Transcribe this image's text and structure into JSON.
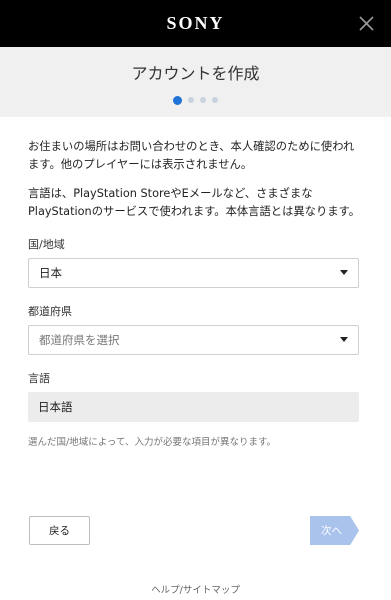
{
  "header": {
    "brand": "SONY",
    "title": "アカウントを作成",
    "steps_total": 4,
    "steps_current": 1
  },
  "intro": {
    "text1": "お住まいの場所はお問い合わせのとき、本人確認のために使われます。他のプレイヤーには表示されません。",
    "text2": "言語は、PlayStation StoreやEメールなど、さまざまなPlayStationのサービスで使われます。本体言語とは異なります。"
  },
  "fields": {
    "country": {
      "label": "国/地域",
      "value": "日本"
    },
    "prefecture": {
      "label": "都道府県",
      "placeholder": "都道府県を選択"
    },
    "language": {
      "label": "言語",
      "value": "日本語"
    }
  },
  "note": "選んだ国/地域によって、入力が必要な項目が異なります。",
  "buttons": {
    "back": "戻る",
    "next": "次へ"
  },
  "footer": {
    "link": "ヘルプ/サイトマップ"
  },
  "colors": {
    "accent": "#1f72d6",
    "next_disabled": "#aac3ec",
    "topbar": "#000000"
  },
  "icons": {
    "close": "close-icon",
    "dropdown": "chevron-down-icon"
  }
}
